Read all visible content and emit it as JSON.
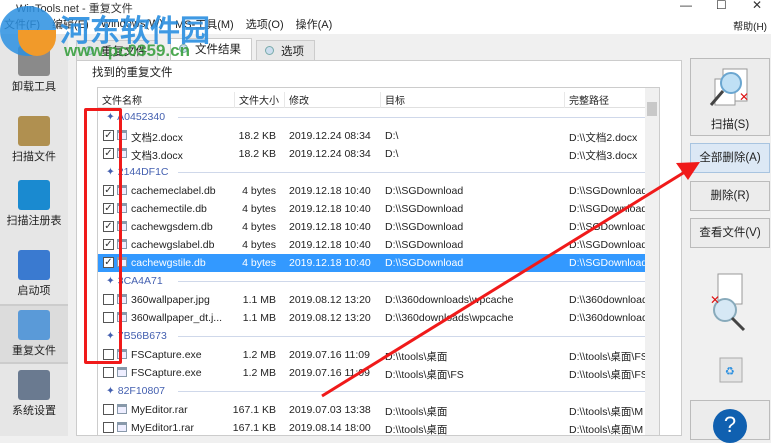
{
  "window": {
    "title": "WinTools.net - 重复文件",
    "minimize": "—",
    "maximize": "☐",
    "close": "✕"
  },
  "menu": [
    "文件(F)",
    "编辑(E)",
    "Windows(W)",
    "MS-工具(M)",
    "选项(O)",
    "操作(A)"
  ],
  "menu_help": "帮助(H)",
  "watermark": {
    "name": "河东软件园",
    "url": "www.pc0359.cn"
  },
  "sidebar": [
    {
      "label": "卸载工具",
      "icon": "uninstall-icon",
      "color": "#8a8a8a"
    },
    {
      "label": "扫描文件",
      "icon": "scan-files-icon",
      "color": "#b09050"
    },
    {
      "label": "扫描注册表",
      "icon": "registry-icon",
      "color": "#1a8ad0"
    },
    {
      "label": "启动项",
      "icon": "startup-icon",
      "color": "#3a7ad0"
    },
    {
      "label": "重复文件",
      "icon": "duplicate-files-icon",
      "color": "#5a9ad8",
      "active": true
    },
    {
      "label": "系统设置",
      "icon": "system-settings-icon",
      "color": "#6a7a90"
    }
  ],
  "tabs": [
    {
      "label": "重复文件"
    },
    {
      "label": "文件结果",
      "active": true
    },
    {
      "label": "选项"
    }
  ],
  "group_label": "找到的重复文件",
  "columns": [
    "文件名称",
    "文件大小",
    "修改",
    "目标",
    "完整路径"
  ],
  "items": [
    {
      "group": "A0452340"
    },
    {
      "checked": true,
      "name": "文档2.docx",
      "size": "18.2 KB",
      "date": "2019.12.24 08:34",
      "target": "D:\\",
      "path": "D:\\\\文档2.docx"
    },
    {
      "checked": true,
      "name": "文档3.docx",
      "size": "18.2 KB",
      "date": "2019.12.24 08:34",
      "target": "D:\\",
      "path": "D:\\\\文档3.docx"
    },
    {
      "group": "2144DF1C"
    },
    {
      "checked": true,
      "name": "cachemeclabel.db",
      "size": "4 bytes",
      "date": "2019.12.18 10:40",
      "target": "D:\\\\SGDownload",
      "path": "D:\\\\SGDownload"
    },
    {
      "checked": true,
      "name": "cachemectile.db",
      "size": "4 bytes",
      "date": "2019.12.18 10:40",
      "target": "D:\\\\SGDownload",
      "path": "D:\\\\SGDownload"
    },
    {
      "checked": true,
      "name": "cachewgsdem.db",
      "size": "4 bytes",
      "date": "2019.12.18 10:40",
      "target": "D:\\\\SGDownload",
      "path": "D:\\\\SGDownload"
    },
    {
      "checked": true,
      "name": "cachewgslabel.db",
      "size": "4 bytes",
      "date": "2019.12.18 10:40",
      "target": "D:\\\\SGDownload",
      "path": "D:\\\\SGDownload"
    },
    {
      "checked": true,
      "selected": true,
      "name": "cachewgstile.db",
      "size": "4 bytes",
      "date": "2019.12.18 10:40",
      "target": "D:\\\\SGDownload",
      "path": "D:\\\\SGDownload"
    },
    {
      "group": "3CA4A71"
    },
    {
      "checked": false,
      "name": "360wallpaper.jpg",
      "size": "1.1 MB",
      "date": "2019.08.12 13:20",
      "target": "D:\\\\360downloads\\wpcache",
      "path": "D:\\\\360download"
    },
    {
      "checked": false,
      "name": "360wallpaper_dt.j...",
      "size": "1.1 MB",
      "date": "2019.08.12 13:20",
      "target": "D:\\\\360downloads\\wpcache",
      "path": "D:\\\\360download"
    },
    {
      "group": "7B56B673"
    },
    {
      "checked": false,
      "name": "FSCapture.exe",
      "size": "1.2 MB",
      "date": "2019.07.16 11:09",
      "target": "D:\\\\tools\\桌面",
      "path": "D:\\\\tools\\桌面\\FS"
    },
    {
      "checked": false,
      "name": "FSCapture.exe",
      "size": "1.2 MB",
      "date": "2019.07.16 11:09",
      "target": "D:\\\\tools\\桌面\\FS",
      "path": "D:\\\\tools\\桌面\\FS"
    },
    {
      "group": "82F10807"
    },
    {
      "checked": false,
      "name": "MyEditor.rar",
      "size": "167.1 KB",
      "date": "2019.07.03 13:38",
      "target": "D:\\\\tools\\桌面",
      "path": "D:\\\\tools\\桌面\\M"
    },
    {
      "checked": false,
      "name": "MyEditor1.rar",
      "size": "167.1 KB",
      "date": "2019.08.14 18:00",
      "target": "D:\\\\tools\\桌面",
      "path": "D:\\\\tools\\桌面\\M"
    }
  ],
  "buttons": {
    "scan": "扫描(S)",
    "delete_all": "全部删除(A)",
    "delete": "删除(R)",
    "view": "查看文件(V)",
    "help": "?"
  },
  "annotation_color": "#f01a1a"
}
